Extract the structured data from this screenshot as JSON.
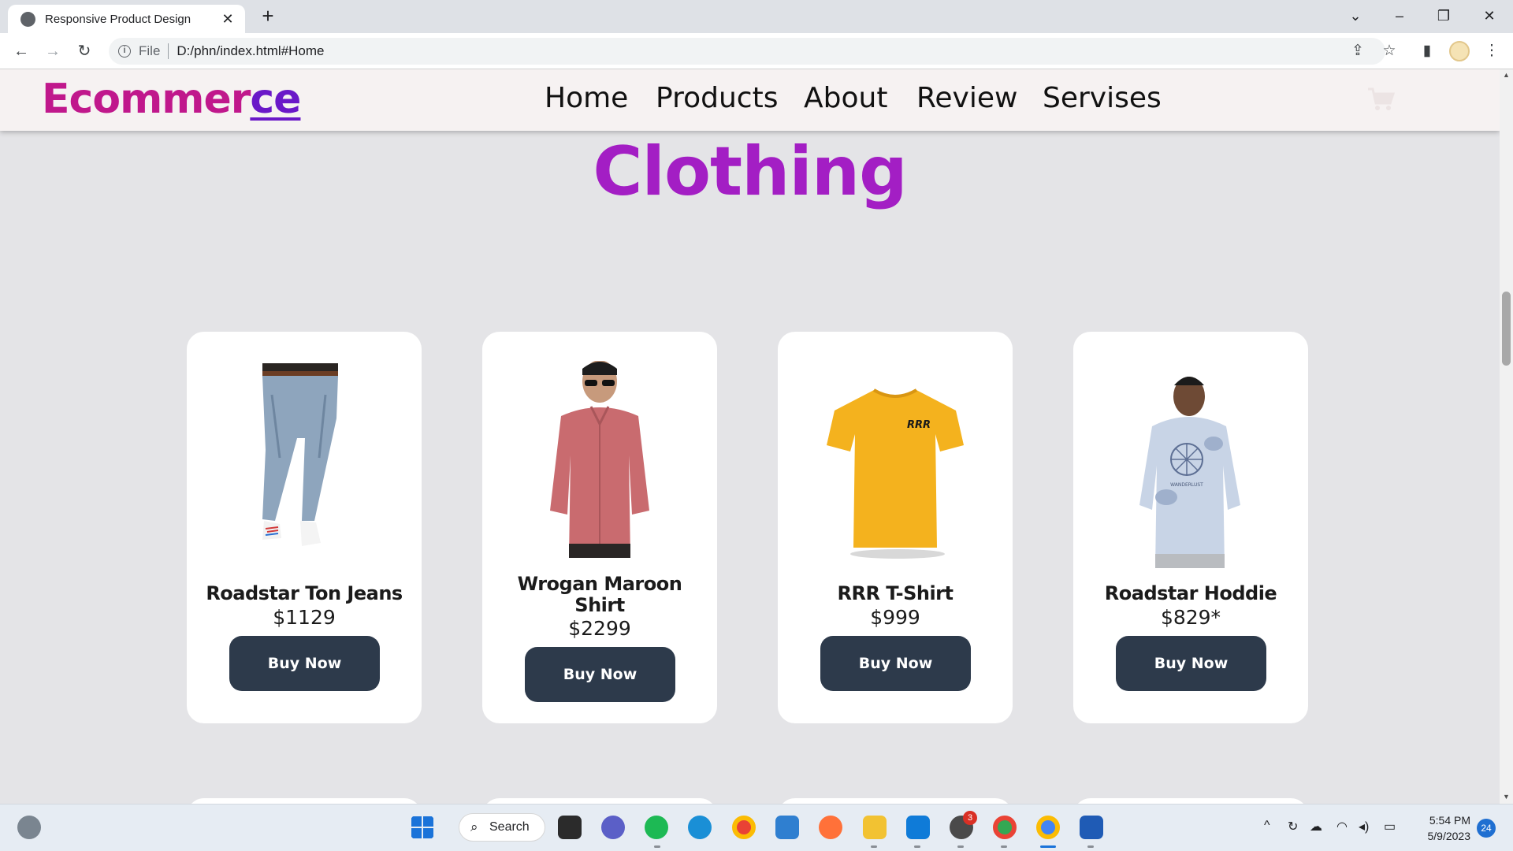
{
  "browser": {
    "tab_title": "Responsive Product Design",
    "tab_close": "✕",
    "new_tab": "+",
    "url_scheme": "File",
    "url": "D:/phn/index.html#Home",
    "info_glyph": "i"
  },
  "site": {
    "logo_main": "Ecommer",
    "logo_tail": "ce",
    "nav": [
      "Home",
      "Products",
      "About",
      "Review",
      "Servises"
    ],
    "heading": "Clothing",
    "colors": {
      "logo": "#c0188c",
      "logo_tail": "#6a18c8",
      "heading": "#a31ec4",
      "button": "#2d3a4b"
    }
  },
  "products": [
    {
      "name": "Roadstar Ton Jeans",
      "price": "$1129",
      "button": "Buy Now",
      "image_icon": "jeans-model-image"
    },
    {
      "name": "Wrogan Maroon Shirt",
      "price": "$2299",
      "button": "Buy Now",
      "image_icon": "shirt-model-image"
    },
    {
      "name": "RRR T-Shirt",
      "price": "$999",
      "button": "Buy Now",
      "image_icon": "yellow-tshirt-image",
      "print": "RRR"
    },
    {
      "name": "Roadstar Hoddie",
      "price": "$829*",
      "button": "Buy Now",
      "image_icon": "hoodie-model-image",
      "print": "WANDERLUST"
    }
  ],
  "taskbar": {
    "search_label": "Search",
    "time": "5:54 PM",
    "date": "5/9/2023",
    "notifications": "24",
    "whatsapp_badge": "3"
  }
}
